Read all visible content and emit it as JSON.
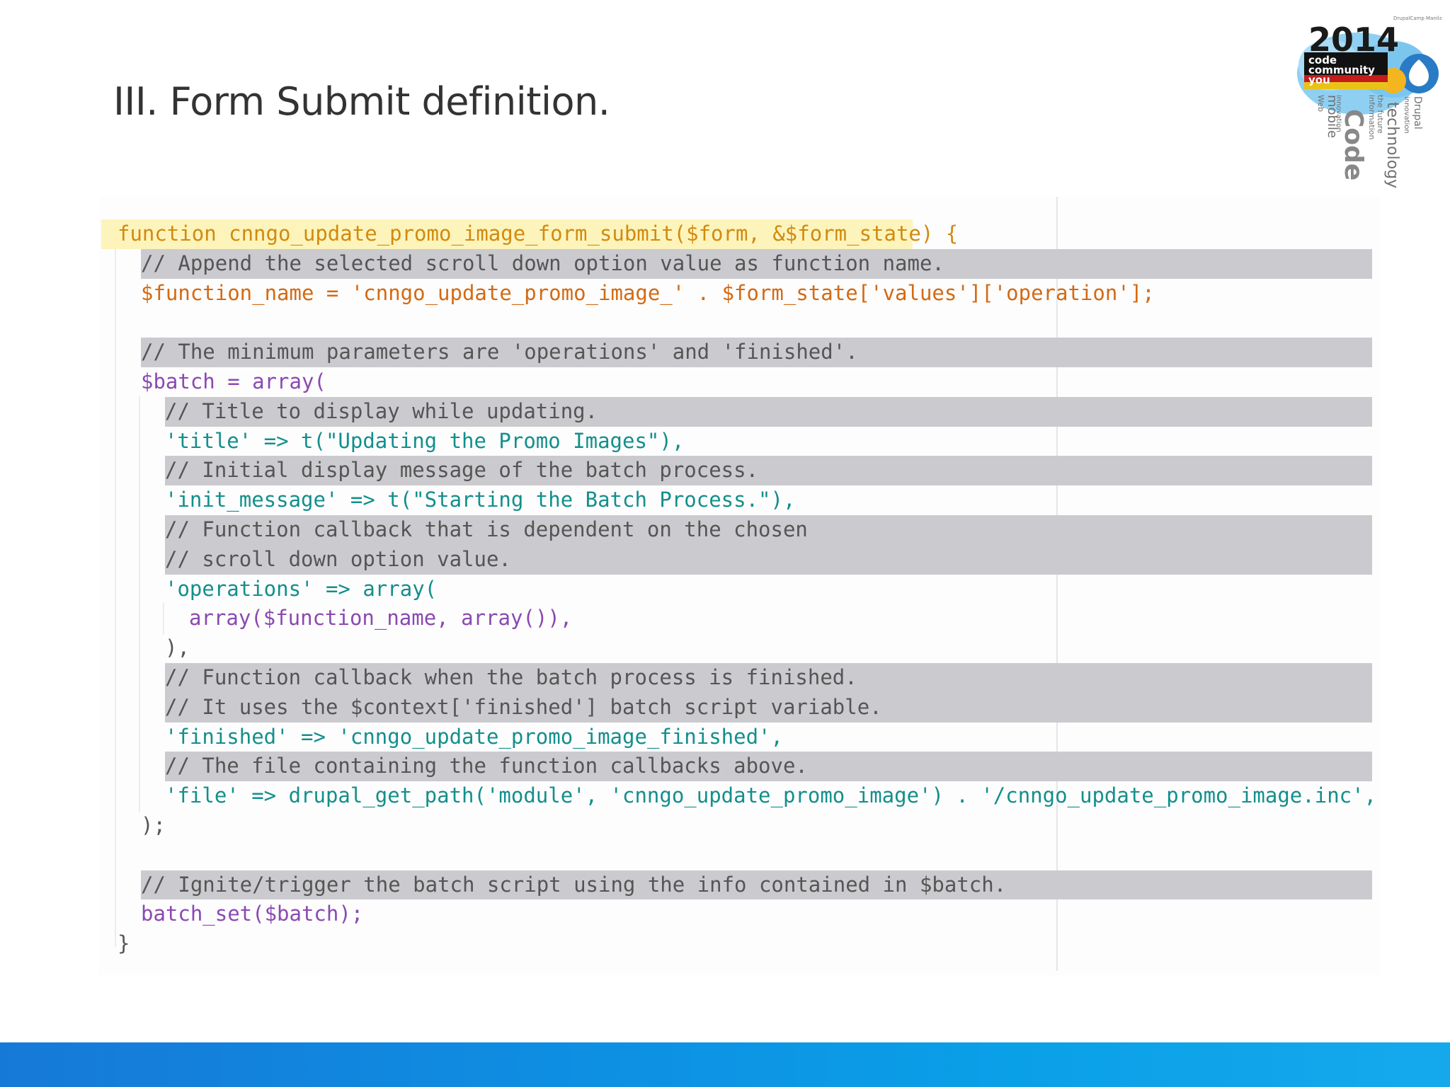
{
  "slide": {
    "title": "III. Form Submit definition."
  },
  "logo": {
    "year": "2014",
    "tagline_lines": [
      "code",
      "community",
      "you"
    ],
    "small_top_text": "DrupalCamp Manila",
    "cloud_words": [
      "Web",
      "mobile",
      "innovation",
      "Code",
      "information",
      "the future",
      "technology",
      "innovation",
      "Drupal"
    ]
  },
  "code": {
    "lines": [
      "function cnngo_update_promo_image_form_submit($form, &$form_state) {",
      "// Append the selected scroll down option value as function name.",
      "$function_name = 'cnngo_update_promo_image_' . $form_state['values']['operation'];",
      "",
      "// The minimum parameters are 'operations' and 'finished'.",
      "$batch = array(",
      "// Title to display while updating.",
      "'title' => t(\"Updating the Promo Images\"),",
      "// Initial display message of the batch process.",
      "'init_message' => t(\"Starting the Batch Process.\"),",
      "// Function callback that is dependent on the chosen",
      "// scroll down option value.",
      "'operations' => array(",
      "array($function_name, array()),",
      "),",
      "// Function callback when the batch process is finished.",
      "// It uses the $context['finished'] batch script variable.",
      "'finished' => 'cnngo_update_promo_image_finished',",
      "// The file containing the function callbacks above.",
      "'file' => drupal_get_path('module', 'cnngo_update_promo_image') . '/cnngo_update_promo_image.inc',",
      ");",
      "",
      "// Ignite/trigger the batch script using the info contained in $batch.",
      "batch_set($batch);",
      "}"
    ]
  },
  "colors": {
    "keyword": "#d18a10",
    "variable": "#d36a12",
    "string": "#138f8b",
    "call": "#8b49b1",
    "operator": "#d13068",
    "comment_band": "#cbcbcf",
    "function_highlight": "#fdf4bb",
    "footer_band": "#0e8fe2"
  }
}
